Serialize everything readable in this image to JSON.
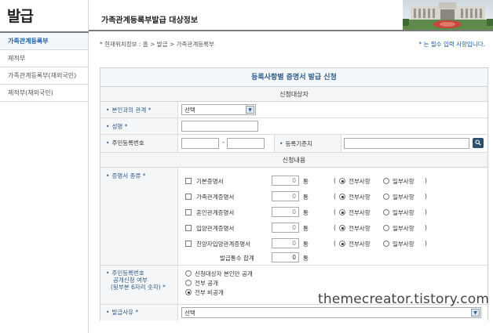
{
  "sidebar": {
    "brand": "발급",
    "items": [
      {
        "label": "가족관계등록부"
      },
      {
        "label": "제적부"
      },
      {
        "label": "가족관계등록부(재외국민)"
      },
      {
        "label": "제적부(재외국민)"
      }
    ]
  },
  "header": {
    "title": "가족관계등록부발급 대상정보"
  },
  "breadcrumb": "* 현재위치정보 : 홈 > 발급 > 가족관계등록부",
  "required_note": "* 는 필수 입력 사항입니다.",
  "form": {
    "title": "등록사항별 증명서 발급 신청",
    "applicant_section": "신청대상자",
    "relationship": {
      "label": "본인과의 관계 *",
      "value": "선택"
    },
    "name": {
      "label": "성명 *",
      "value": ""
    },
    "resident_number": {
      "label": "주민등록번호",
      "separator": "-"
    },
    "registry_base": {
      "label": "등록기준지"
    },
    "request_section": "신청내용",
    "cert_type": {
      "label": "증명서 종류 *",
      "unit": "통",
      "option_all": "전부사항",
      "option_partial": "일부사항",
      "items": [
        {
          "name": "기본증명서",
          "count": "0"
        },
        {
          "name": "가족관계증명서",
          "count": "0"
        },
        {
          "name": "혼인관계증명서",
          "count": "0"
        },
        {
          "name": "입양관계증명서",
          "count": "0"
        },
        {
          "name": "친양자입양관계증명서",
          "count": "0"
        }
      ],
      "total_label": "발급통수 합계",
      "total": "0"
    },
    "disclosure": {
      "label_line1": "주민등록번호",
      "label_line2": "공개신청 여부",
      "label_line3": "(뒷부분 6자리 숫자) *",
      "options": [
        {
          "label": "신청대상자 본인만 공개",
          "selected": false
        },
        {
          "label": "전부 공개",
          "selected": false
        },
        {
          "label": "전부 비공개",
          "selected": true
        }
      ]
    },
    "reason": {
      "label": "발급사유 *",
      "value": "선택"
    }
  },
  "watermark": "themecreator.tistory.com"
}
